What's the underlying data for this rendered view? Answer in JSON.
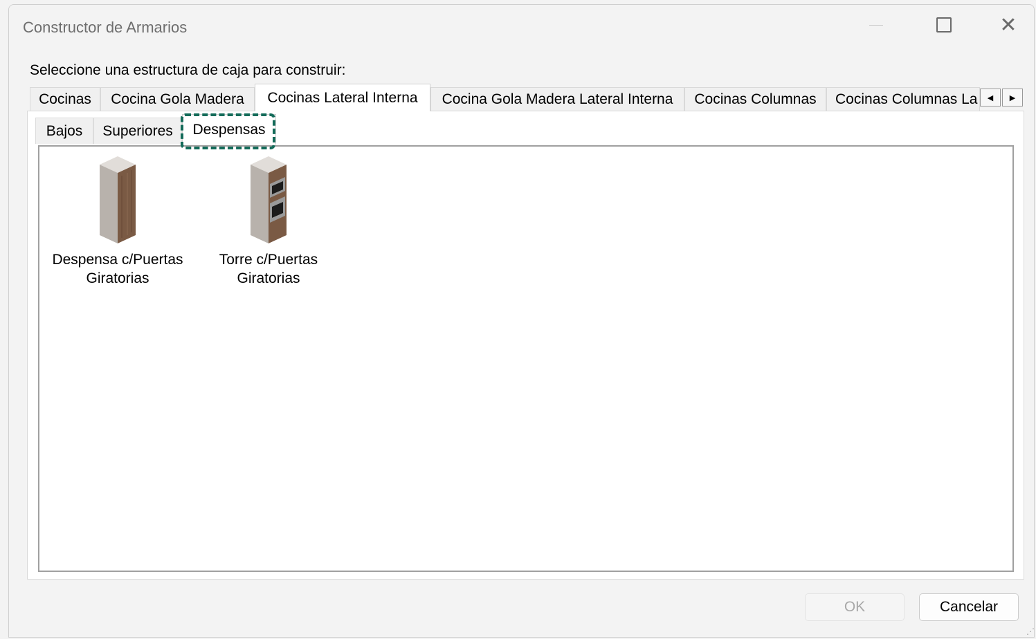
{
  "window": {
    "title": "Constructor de Armarios",
    "minimize_icon": "minimize-icon",
    "maximize_icon": "maximize-icon",
    "close_icon": "close-icon",
    "close_glyph": "✕"
  },
  "prompt": "Seleccione una estructura de caja para construir:",
  "outer_tabs": [
    {
      "label": "Cocinas",
      "active": false
    },
    {
      "label": "Cocina Gola Madera",
      "active": false
    },
    {
      "label": "Cocinas Lateral Interna",
      "active": true
    },
    {
      "label": "Cocina Gola Madera Lateral Interna",
      "active": false
    },
    {
      "label": "Cocinas Columnas",
      "active": false
    },
    {
      "label": "Cocinas Columnas La",
      "active": false
    }
  ],
  "tab_scroll": {
    "left_icon": "arrow-left-icon",
    "right_icon": "arrow-right-icon",
    "left_glyph": "◀",
    "right_glyph": "▶"
  },
  "inner_tabs": [
    {
      "label": "Bajos",
      "active": false
    },
    {
      "label": "Superiores",
      "active": false
    },
    {
      "label": "Despensas",
      "active": true
    }
  ],
  "items": [
    {
      "line1": "Despensa c/Puertas",
      "line2": "Giratorias",
      "icon": "pantry-cabinet-icon"
    },
    {
      "line1": "Torre c/Puertas",
      "line2": "Giratorias",
      "icon": "oven-tower-icon"
    }
  ],
  "buttons": {
    "ok": "OK",
    "cancel": "Cancelar",
    "ok_enabled": false
  },
  "colors": {
    "highlight": "#136b59",
    "wood": "#7a5a44",
    "panel": "#b8b2ac"
  }
}
